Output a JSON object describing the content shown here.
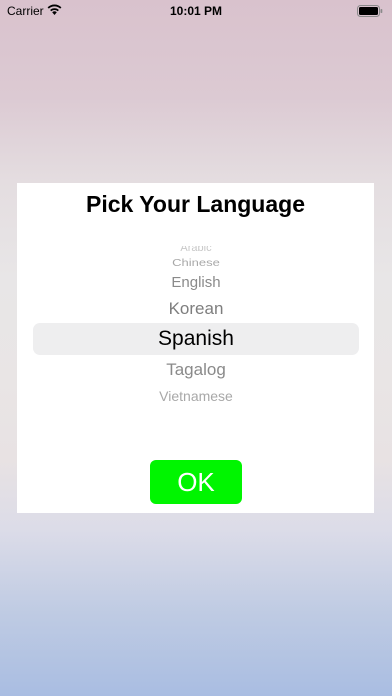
{
  "status_bar": {
    "carrier": "Carrier",
    "time": "10:01 PM",
    "icons": [
      "wifi-icon",
      "battery-icon"
    ]
  },
  "dialog": {
    "title": "Pick Your Language",
    "picker": {
      "options": [
        "Arabic",
        "Chinese",
        "English",
        "Korean",
        "Spanish",
        "Tagalog",
        "Vietnamese"
      ],
      "selected": "Spanish"
    },
    "ok_label": "OK"
  },
  "colors": {
    "ok_button": "#00f500",
    "dialog_background": "#ffffff",
    "picker_highlight": "#eeeeef"
  }
}
